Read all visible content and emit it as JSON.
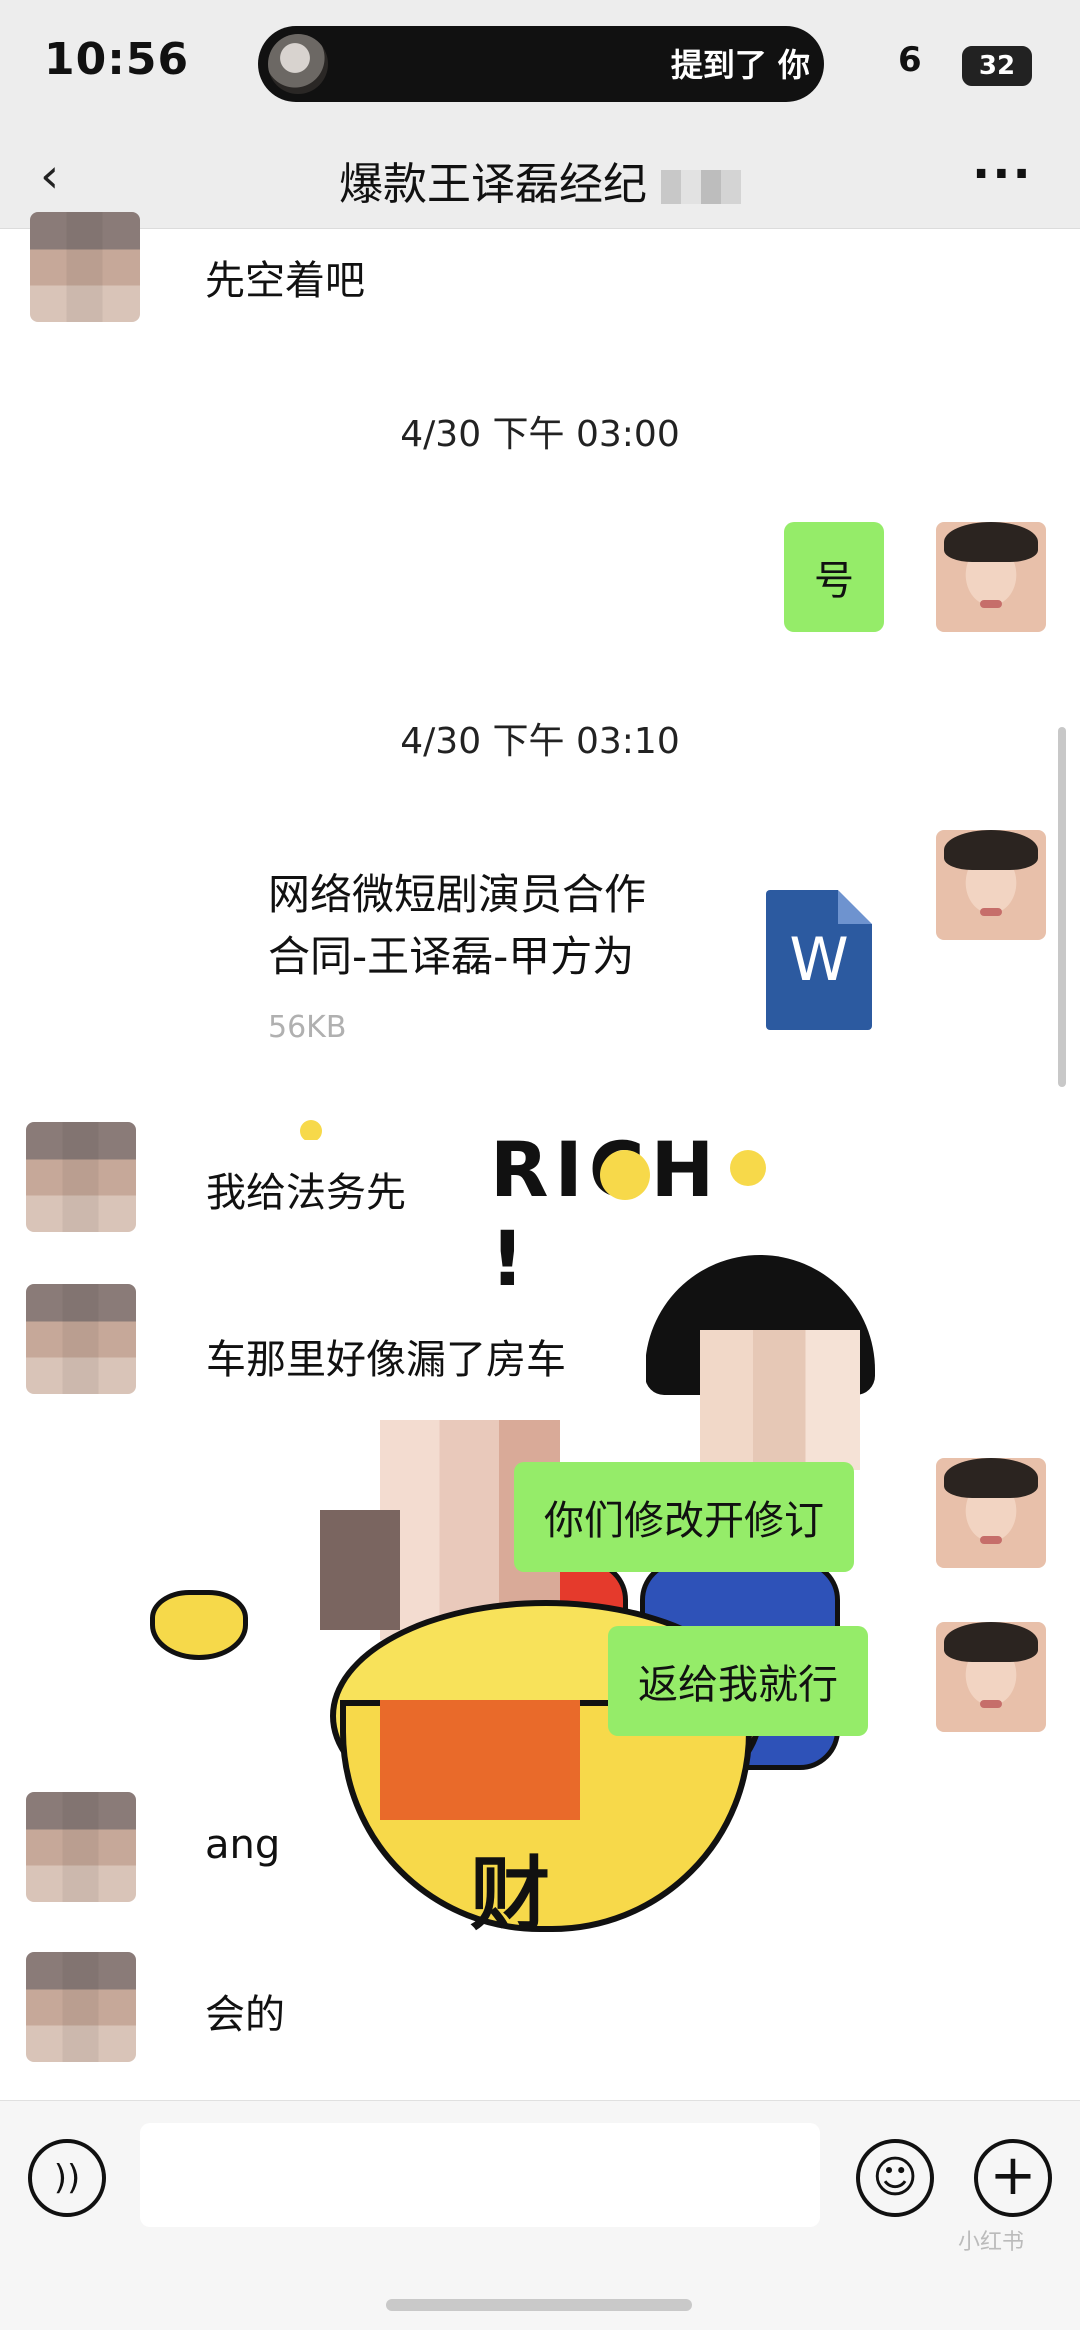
{
  "status": {
    "time": "10:56",
    "island_text": "提到了 你",
    "signal": "6",
    "battery": "32"
  },
  "nav": {
    "back": "‹",
    "title": "爆款王译磊经纪",
    "more": "···"
  },
  "messages": {
    "m1": "先空着吧",
    "t1": "4/30 下午 03:00",
    "m2": "号",
    "t2": "4/30 下午 03:10",
    "file": {
      "name_line1": "网络微短剧演员合作",
      "name_line2": "合同-王译磊-甲方为",
      "size": "56KB",
      "icon": "W"
    },
    "m3": "我给法务先",
    "m4": "车那里好像漏了房车",
    "m5": "你们修改开修订",
    "m6": "返给我就行",
    "m7": "ang",
    "m8": "会的"
  },
  "sticker": {
    "rich": "RICH !",
    "cai": "财"
  },
  "bottom": {
    "voice_icon": "))",
    "emoji_icon": "☺",
    "plus_icon": "+"
  },
  "watermark": "小红书"
}
